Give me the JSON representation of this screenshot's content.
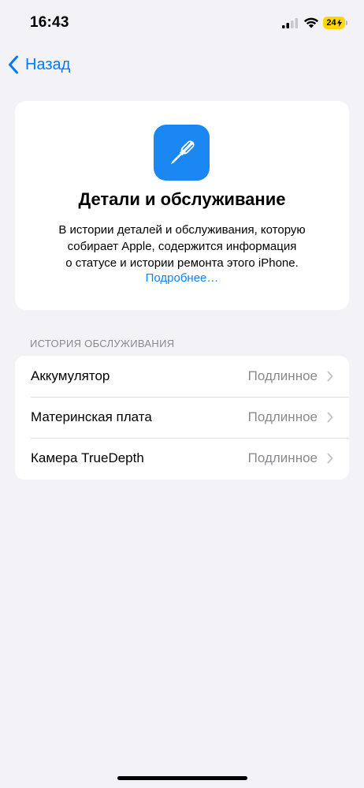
{
  "status_bar": {
    "time": "16:43",
    "battery_text": "24"
  },
  "nav": {
    "back_label": "Назад"
  },
  "header": {
    "icon": "screwdriver-icon",
    "title": "Детали и обслуживание",
    "description_lines": [
      "В истории деталей и обслуживания, которую",
      "собирает Apple, содержится информация",
      "о статусе и истории ремонта этого iPhone."
    ],
    "more_link": "Подробнее…"
  },
  "service_history": {
    "section_title": "ИСТОРИЯ ОБСЛУЖИВАНИЯ",
    "rows": [
      {
        "label": "Аккумулятор",
        "value": "Подлинное"
      },
      {
        "label": "Материнская плата",
        "value": "Подлинное"
      },
      {
        "label": "Камера TrueDepth",
        "value": "Подлинное"
      }
    ]
  },
  "colors": {
    "accent": "#007aff",
    "icon_bg": "#1b87f2",
    "battery": "#ffd60a"
  }
}
